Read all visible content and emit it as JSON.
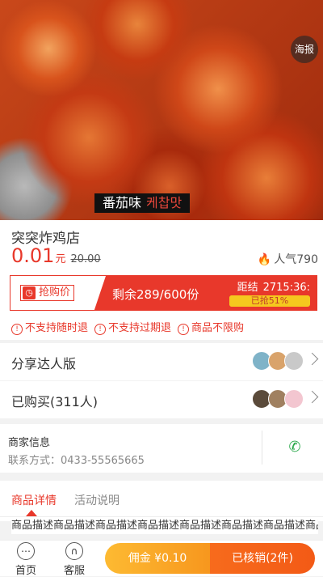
{
  "hero": {
    "poster_label": "海报",
    "caption_cn": "番茄味",
    "caption_kr": "케찹맛"
  },
  "product": {
    "shop_name": "突突炸鸡店",
    "price": "0.01",
    "price_unit": "元",
    "original_price": "20.00",
    "popularity": "人气790"
  },
  "flash_sale": {
    "tag": "抢购价",
    "remaining": "剩余289/600份",
    "countdown_label": "距结",
    "countdown": "2715:36:",
    "progress_text": "已抢51%",
    "progress_percent": 51
  },
  "terms": [
    "不支持随时退",
    "不支持过期退",
    "商品不限购"
  ],
  "share": {
    "label": "分享达人版"
  },
  "bought": {
    "label": "已购买(311人)"
  },
  "merchant": {
    "title": "商家信息",
    "contact": "联系方式：0433-55565665"
  },
  "tabs": {
    "detail": "商品详情",
    "activity": "活动说明"
  },
  "description": "商品描述商品描述商品描述商品描述商品描述商品描述商品描述商品描",
  "bottom_bar": {
    "home": "首页",
    "service": "客服",
    "commission": "佣金 ¥0.10",
    "redeemed": "已核销(2件)"
  },
  "colors": {
    "accent": "#e8382b",
    "gold": "#fdba32",
    "orange": "#f35a16",
    "phone_green": "#2aa84a"
  }
}
